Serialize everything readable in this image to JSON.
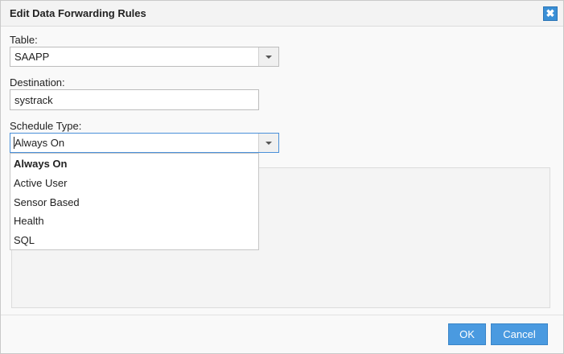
{
  "dialog": {
    "title": "Edit Data Forwarding Rules",
    "close_glyph": "✖"
  },
  "table": {
    "label": "Table:",
    "value": "SAAPP"
  },
  "destination": {
    "label": "Destination:",
    "value": "systrack"
  },
  "schedule": {
    "label": "Schedule Type:",
    "value": "Always On",
    "options": [
      "Always On",
      "Active User",
      "Sensor Based",
      "Health",
      "SQL"
    ],
    "selected_index": 0
  },
  "buttons": {
    "ok": "OK",
    "cancel": "Cancel"
  },
  "colors": {
    "accent": "#4a9ae0",
    "close": "#3a8fd6"
  },
  "icons": {
    "close": "close-icon",
    "dropdown": "chevron-down-icon"
  }
}
